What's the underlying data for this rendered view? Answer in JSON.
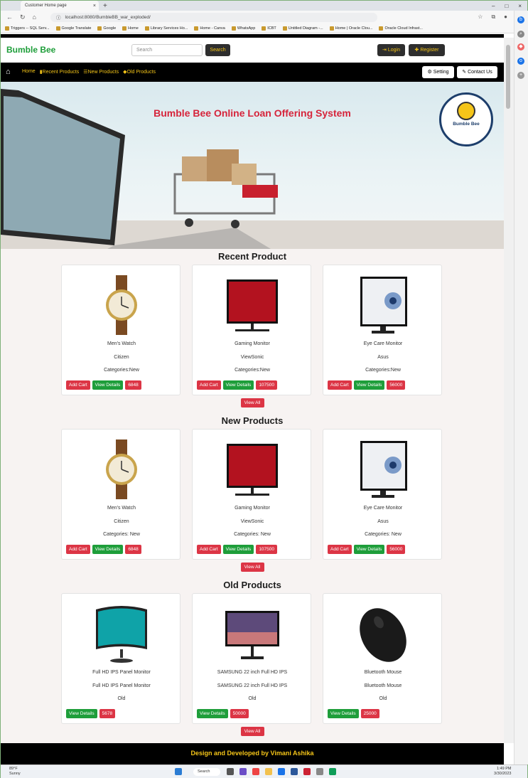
{
  "browser": {
    "tab_title": "Customer Home page",
    "url": "localhost:8080/BumbleBB_war_exploded/",
    "bookmarks": [
      "Triggers -- SQL Serv...",
      "Google Translate",
      "Google",
      "Home",
      "Library Services Ho...",
      "Home - Canva",
      "WhatsApp",
      "ICBT",
      "Untitled Diagram -...",
      "Home | Oracle Clou...",
      "Oracle Cloud Infrast..."
    ]
  },
  "header": {
    "logo": "Bumble Bee",
    "search_placeholder": "Search",
    "search_button": "Search",
    "login": "Login",
    "register": "Register"
  },
  "nav": {
    "links": [
      "Home",
      "Recent Products",
      "New Products",
      "Old Products"
    ],
    "setting": "Setting",
    "contact": "Contact Us"
  },
  "hero": {
    "title": "Bumble Bee Online Loan Offering System",
    "badge_name": "Bumble Bee"
  },
  "sections": [
    {
      "title": "Recent Product",
      "view_all": "View All",
      "products": [
        {
          "name": "Men's Watch",
          "brand": "Citizen",
          "category": "Categories:New",
          "add": "Add Cart",
          "view": "View Details",
          "price": "6848",
          "image": "watch"
        },
        {
          "name": "Gaming Monitor",
          "brand": "ViewSonic",
          "category": "Categories:New",
          "add": "Add Cart",
          "view": "View Details",
          "price": "107500",
          "image": "viewsonic"
        },
        {
          "name": "Eye Care Monitor",
          "brand": "Asus",
          "category": "Categories:New",
          "add": "Add Cart",
          "view": "View Details",
          "price": "56000",
          "image": "asus"
        }
      ]
    },
    {
      "title": "New Products",
      "view_all": "View All",
      "products": [
        {
          "name": "Men's Watch",
          "brand": "Citizen",
          "category": "Categories: New",
          "add": "Add Cart",
          "view": "View Details",
          "price": "6848",
          "image": "watch"
        },
        {
          "name": "Gaming Monitor",
          "brand": "ViewSonic",
          "category": "Categories: New",
          "add": "Add Cart",
          "view": "View Details",
          "price": "107500",
          "image": "viewsonic"
        },
        {
          "name": "Eye Care Monitor",
          "brand": "Asus",
          "category": "Categories: New",
          "add": "Add Cart",
          "view": "View Details",
          "price": "56000",
          "image": "asus"
        }
      ]
    },
    {
      "title": "Old Products",
      "view_all": "View All",
      "products": [
        {
          "name": "Full HD IPS Panel Monitor",
          "brand": "Full HD IPS Panel Monitor",
          "category": "Old",
          "view": "View Details",
          "price": "5678",
          "image": "samsung-curved"
        },
        {
          "name": "SAMSUNG 22 inch Full HD IPS",
          "brand": "SAMSUNG 22 inch Full HD IPS",
          "category": "Old",
          "view": "View Details",
          "price": "50000",
          "image": "samsung-flat"
        },
        {
          "name": "Bluetooth Mouse",
          "brand": "Bluetooth Mouse",
          "category": "Old",
          "view": "View Details",
          "price": "25000",
          "image": "mouse"
        }
      ]
    }
  ],
  "footer": "Design and Developed by Vimani Ashika",
  "taskbar": {
    "temp": "89°F",
    "weather": "Sunny",
    "search": "Search",
    "time": "1:49 PM",
    "date": "3/30/2023"
  },
  "colors": {
    "brand_green": "#1e9e3a",
    "accent_yellow": "#f5c518",
    "danger_red": "#dc3545",
    "hero_title": "#d6243b"
  }
}
